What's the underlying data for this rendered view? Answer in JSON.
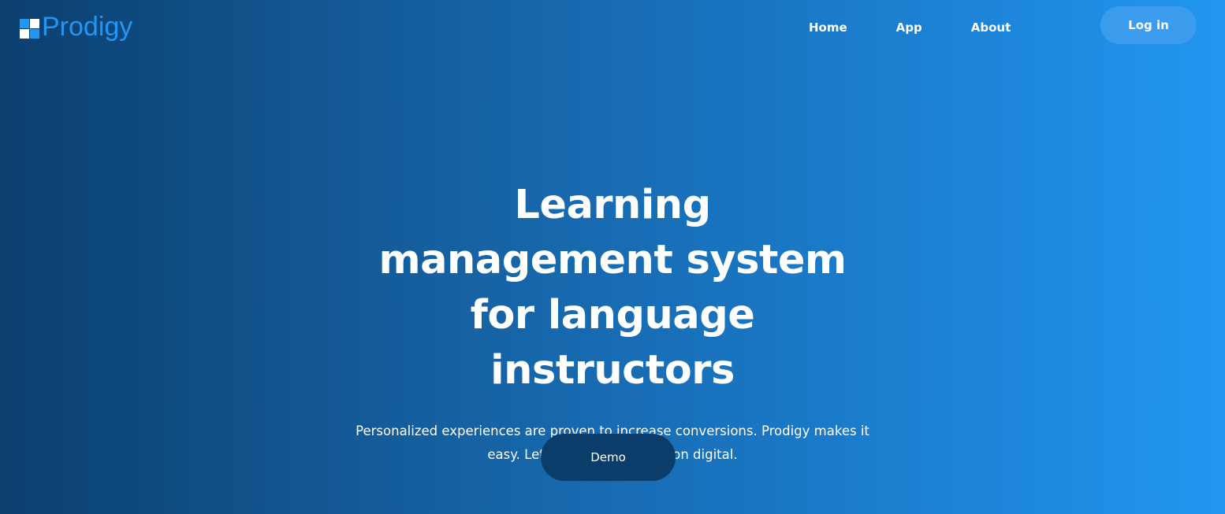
{
  "header": {
    "brand": "Prodigy",
    "logo_icon": "grid-squares-logo",
    "nav": [
      {
        "label": "Home"
      },
      {
        "label": "App"
      },
      {
        "label": "About"
      }
    ],
    "login_label": "Log in"
  },
  "hero": {
    "title": "Learning management system for language instructors",
    "subtitle": "Personalized experiences are proven to increase conversions. Prodigy makes it easy. Let's make the education digital.",
    "cta_label": "Demo"
  },
  "colors": {
    "brand": "#2196f3",
    "gradient_start": "#0b3f6e",
    "gradient_end": "#2196f0",
    "cta_background": "#0a3d6a",
    "text": "#ffffff"
  }
}
